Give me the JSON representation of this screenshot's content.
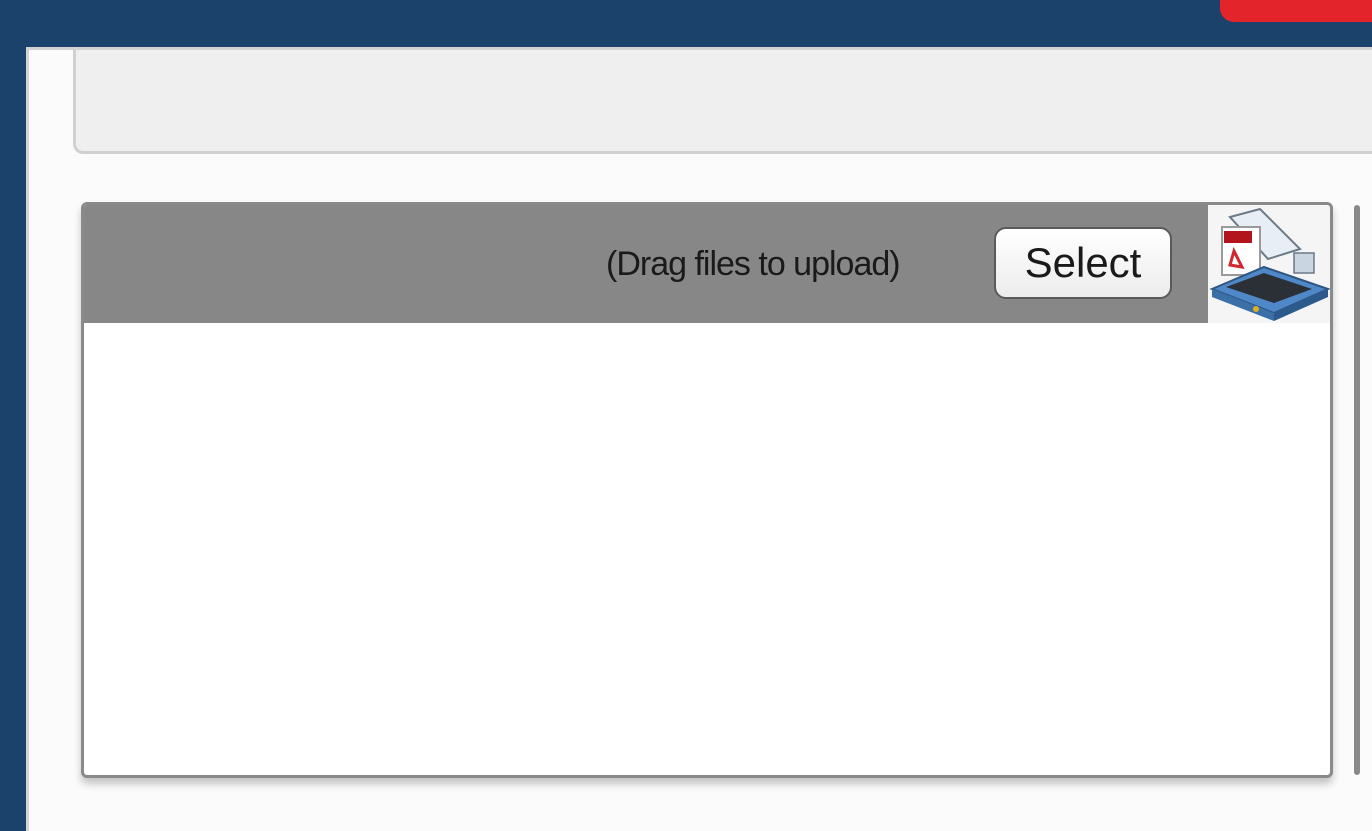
{
  "uploader": {
    "drag_hint": "(Drag files to upload)",
    "select_label": "Select",
    "icon": "scanner-pdf-icon"
  },
  "colors": {
    "frame": "#1b426b",
    "accent": "#e3242b",
    "header": "#878787"
  }
}
